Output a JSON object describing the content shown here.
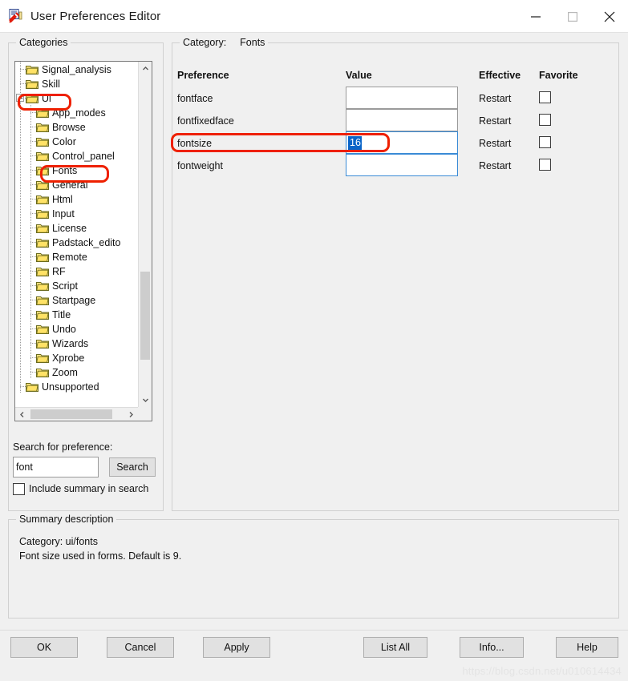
{
  "window": {
    "title": "User Preferences Editor",
    "icon": "preferences-editor-icon",
    "minimize_label": "minimize-icon",
    "maximize_label": "maximize-icon",
    "close_label": "close-icon"
  },
  "categories_panel": {
    "legend": "Categories",
    "tree": [
      {
        "label": "Signal_analysis",
        "depth": 1,
        "expander": "none"
      },
      {
        "label": "Skill",
        "depth": 1,
        "expander": "none"
      },
      {
        "label": "Ui",
        "depth": 1,
        "expander": "collapse",
        "highlighted": true
      },
      {
        "label": "App_modes",
        "depth": 2,
        "expander": "none"
      },
      {
        "label": "Browse",
        "depth": 2,
        "expander": "none"
      },
      {
        "label": "Color",
        "depth": 2,
        "expander": "none"
      },
      {
        "label": "Control_panel",
        "depth": 2,
        "expander": "none"
      },
      {
        "label": "Fonts",
        "depth": 2,
        "expander": "none",
        "highlighted": true
      },
      {
        "label": "General",
        "depth": 2,
        "expander": "none"
      },
      {
        "label": "Html",
        "depth": 2,
        "expander": "none"
      },
      {
        "label": "Input",
        "depth": 2,
        "expander": "none"
      },
      {
        "label": "License",
        "depth": 2,
        "expander": "none"
      },
      {
        "label": "Padstack_edito",
        "depth": 2,
        "expander": "none"
      },
      {
        "label": "Remote",
        "depth": 2,
        "expander": "none"
      },
      {
        "label": "RF",
        "depth": 2,
        "expander": "none"
      },
      {
        "label": "Script",
        "depth": 2,
        "expander": "none"
      },
      {
        "label": "Startpage",
        "depth": 2,
        "expander": "none"
      },
      {
        "label": "Title",
        "depth": 2,
        "expander": "none"
      },
      {
        "label": "Undo",
        "depth": 2,
        "expander": "none"
      },
      {
        "label": "Wizards",
        "depth": 2,
        "expander": "none"
      },
      {
        "label": "Xprobe",
        "depth": 2,
        "expander": "none"
      },
      {
        "label": "Zoom",
        "depth": 2,
        "expander": "none"
      },
      {
        "label": "Unsupported",
        "depth": 1,
        "expander": "none"
      }
    ],
    "scroll_up_icon": "chevron-up-icon",
    "scroll_down_icon": "chevron-down-icon",
    "scroll_left_icon": "chevron-left-icon",
    "scroll_right_icon": "chevron-right-icon"
  },
  "search": {
    "label": "Search for preference:",
    "value": "font",
    "placeholder": "",
    "button_label": "Search",
    "include_summary_label": "Include summary in search",
    "include_summary_checked": false
  },
  "category_panel": {
    "legend_prefix": "Category:",
    "legend_value": "Fonts",
    "legend": "Category:   Fonts",
    "columns": [
      "Preference",
      "Value",
      "Effective",
      "Favorite"
    ],
    "rows": [
      {
        "preference": "fontface",
        "value": "",
        "effective": "Restart",
        "favorite": false,
        "focused": false,
        "selected_text": false
      },
      {
        "preference": "fontfixedface",
        "value": "",
        "effective": "Restart",
        "favorite": false,
        "focused": false,
        "selected_text": false
      },
      {
        "preference": "fontsize",
        "value": "16",
        "effective": "Restart",
        "favorite": false,
        "focused": true,
        "selected_text": true
      },
      {
        "preference": "fontweight",
        "value": "",
        "effective": "Restart",
        "favorite": false,
        "focused": true,
        "selected_text": false
      }
    ]
  },
  "summary": {
    "legend": "Summary description",
    "line1": "Category: ui/fonts",
    "line2": "Font size used in forms. Default is 9."
  },
  "footer": {
    "buttons": [
      {
        "label": "OK"
      },
      {
        "label": "Cancel"
      },
      {
        "label": "Apply"
      },
      {
        "label": "List All"
      },
      {
        "label": "Info..."
      },
      {
        "label": "Help"
      }
    ]
  },
  "watermark": {
    "text": "https://blog.csdn.net/u010614434"
  },
  "colors": {
    "annotation_red": "#ee2000",
    "selection_blue": "#0a64c8",
    "focus_border": "#3a8bd6",
    "window_bg": "#f0f0f0"
  }
}
